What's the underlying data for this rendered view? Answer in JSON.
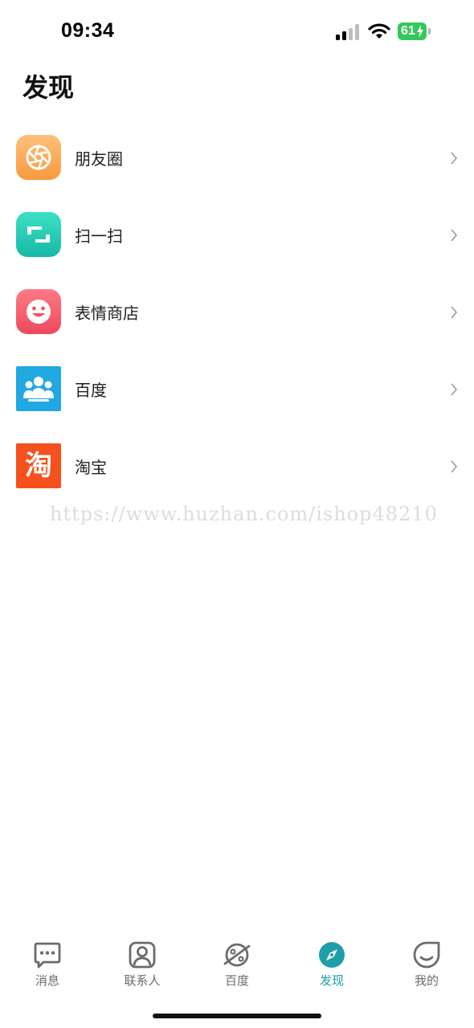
{
  "status_bar": {
    "time": "09:34",
    "battery": "61"
  },
  "page": {
    "title": "发现"
  },
  "menu": [
    {
      "label": "朋友圈",
      "icon": "camera-aperture-icon",
      "color": "#f9a64b"
    },
    {
      "label": "扫一扫",
      "icon": "scan-icon",
      "color": "#23c9b0"
    },
    {
      "label": "表情商店",
      "icon": "smiley-face-icon",
      "color": "#f05c6c"
    },
    {
      "label": "百度",
      "icon": "people-group-icon",
      "color": "#21a8e1"
    },
    {
      "label": "淘宝",
      "icon": "taobao-tao-icon",
      "icon_text": "淘",
      "color": "#f4511e"
    }
  ],
  "watermark": "https://www.huzhan.com/ishop48210",
  "tabs": [
    {
      "label": "消息",
      "icon": "message-bubble-icon",
      "active": false
    },
    {
      "label": "联系人",
      "icon": "contact-person-icon",
      "active": false
    },
    {
      "label": "百度",
      "icon": "planet-icon",
      "active": false
    },
    {
      "label": "发现",
      "icon": "compass-icon",
      "active": true
    },
    {
      "label": "我的",
      "icon": "profile-face-icon",
      "active": false
    }
  ],
  "colors": {
    "accent": "#1f9ea9",
    "tab_inactive": "#6b6b6b"
  }
}
